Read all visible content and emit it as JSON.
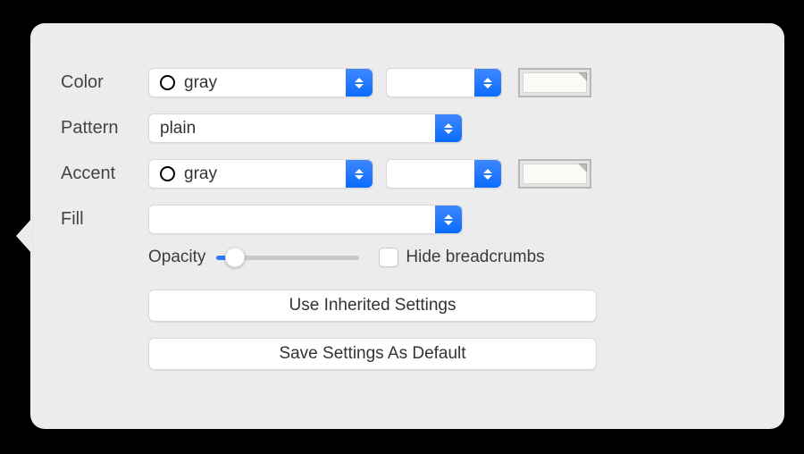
{
  "labels": {
    "color": "Color",
    "pattern": "Pattern",
    "accent": "Accent",
    "fill": "Fill",
    "opacity": "Opacity",
    "hide_breadcrumbs": "Hide breadcrumbs"
  },
  "color": {
    "value": "gray",
    "secondary": ""
  },
  "pattern": {
    "value": "plain"
  },
  "accent": {
    "value": "gray",
    "secondary": ""
  },
  "fill": {
    "value": ""
  },
  "opacity": {
    "value": 0
  },
  "hide_breadcrumbs": false,
  "buttons": {
    "inherit": "Use Inherited Settings",
    "save_default": "Save Settings As Default"
  },
  "swatches": {
    "color": "#fbfbf6",
    "accent": "#fbfbf6"
  }
}
